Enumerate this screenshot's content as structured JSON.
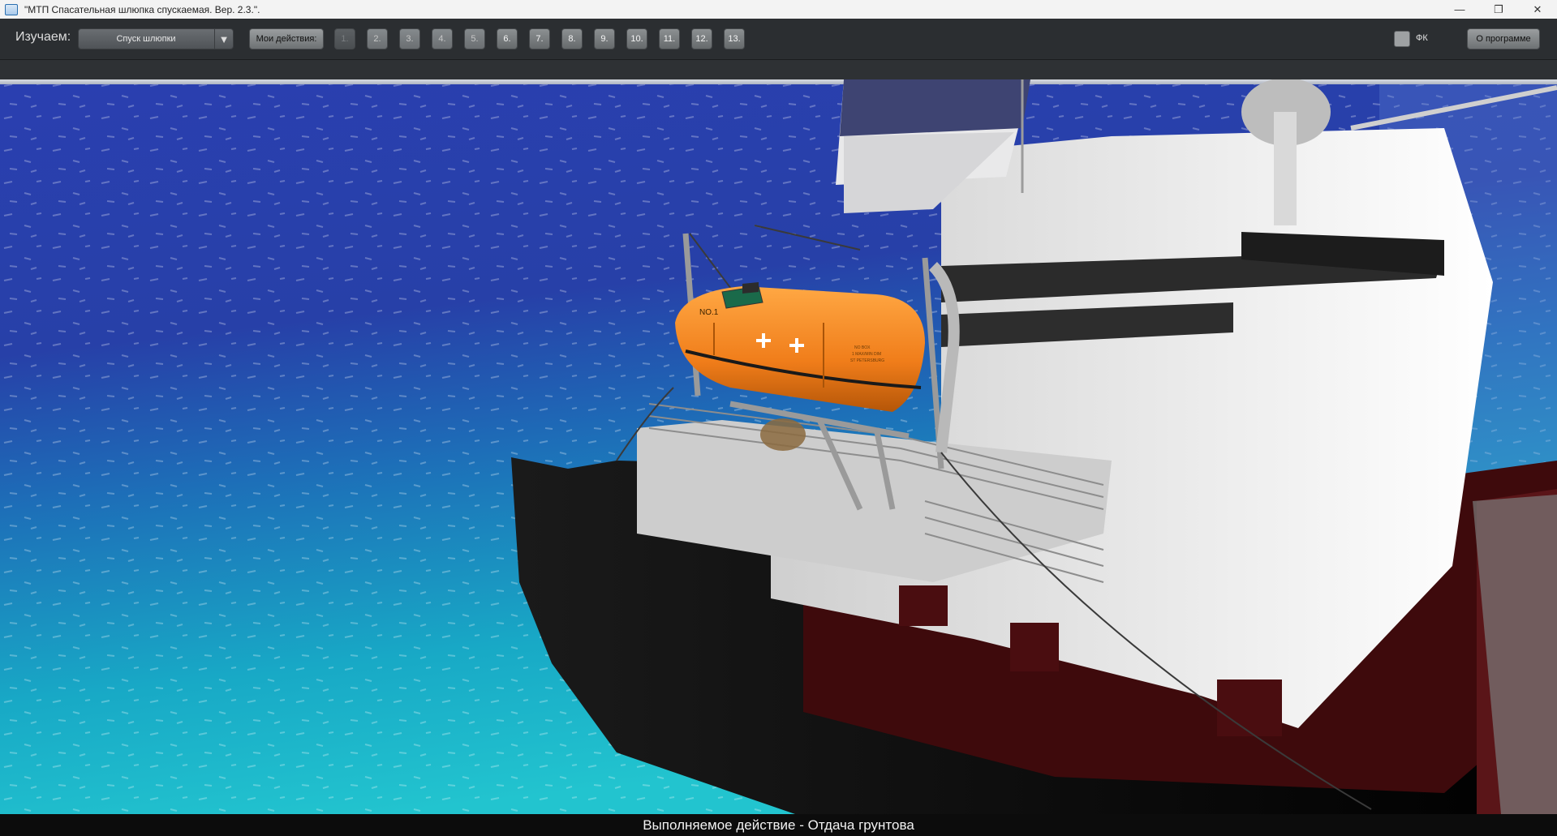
{
  "window": {
    "title": "\"МТП Спасательная шлюпка спускаемая. Вер. 2.3.\".",
    "controls": {
      "minimize": "—",
      "maximize": "❐",
      "close": "✕"
    }
  },
  "toolbar": {
    "studying_label": "Изучаем:",
    "topic_select": {
      "selected": "Спуск шлюпки",
      "arrow": "▼"
    },
    "my_actions_label": "Мои действия:",
    "steps": [
      "1.",
      "2.",
      "3.",
      "4.",
      "5.",
      "6.",
      "7.",
      "8.",
      "9.",
      "10.",
      "11.",
      "12.",
      "13."
    ],
    "fk_checkbox": {
      "label": "ФК",
      "checked": false
    },
    "about_label": "О программе"
  },
  "scene": {
    "boat_label": "NO.1",
    "boat_marking_lines": [
      "NO BOX",
      "1 MAX/MIN DIM",
      "ST PETERSBURG"
    ],
    "colors": {
      "sea_deep": "#1e2f9a",
      "sea_shallow": "#18b4c8",
      "hull": "#0a0a0a",
      "hull_stripe": "#4a0d10",
      "superstructure": "#e8e8e8",
      "lifeboat": "#f07d1a"
    }
  },
  "status": {
    "text": "Выполняемое действие - Отдача грунтова"
  }
}
